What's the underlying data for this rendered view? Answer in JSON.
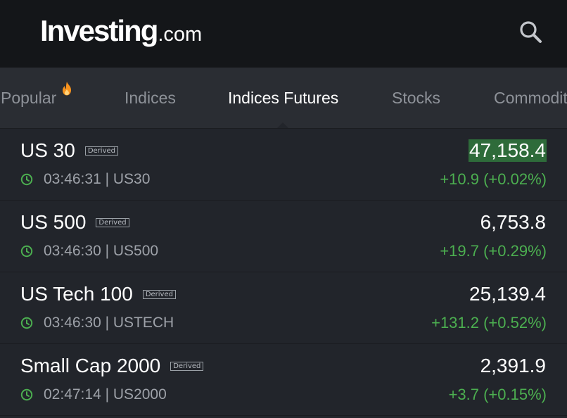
{
  "header": {
    "logo_main": "Investing",
    "logo_tld": ".com",
    "search_icon": "search-icon"
  },
  "tabs": [
    {
      "label": "Popular",
      "active": false,
      "icon": "fire-icon"
    },
    {
      "label": "Indices",
      "active": false
    },
    {
      "label": "Indices Futures",
      "active": true
    },
    {
      "label": "Stocks",
      "active": false
    },
    {
      "label": "Commodit",
      "active": false
    }
  ],
  "rows": [
    {
      "name": "US 30",
      "badge": "Derived",
      "time": "03:46:31",
      "symbol": "US30",
      "meta": "03:46:31 | US30",
      "price": "47,158.4",
      "change": "+10.9 (+0.02%)",
      "highlighted": true
    },
    {
      "name": "US 500",
      "badge": "Derived",
      "time": "03:46:30",
      "symbol": "US500",
      "meta": "03:46:30 | US500",
      "price": "6,753.8",
      "change": "+19.7 (+0.29%)",
      "highlighted": false
    },
    {
      "name": "US Tech 100",
      "badge": "Derived",
      "time": "03:46:30",
      "symbol": "USTECH",
      "meta": "03:46:30 | USTECH",
      "price": "25,139.4",
      "change": "+131.2 (+0.52%)",
      "highlighted": false
    },
    {
      "name": "Small Cap 2000",
      "badge": "Derived",
      "time": "02:47:14",
      "symbol": "US2000",
      "meta": "02:47:14 | US2000",
      "price": "2,391.9",
      "change": "+3.7 (+0.15%)",
      "highlighted": false
    }
  ],
  "colors": {
    "header_bg": "#141619",
    "tabs_bg": "#2a2d33",
    "list_bg": "#22252b",
    "positive": "#4caf50",
    "price_flash": "#2e6b3a",
    "fire": "#f7931e"
  }
}
